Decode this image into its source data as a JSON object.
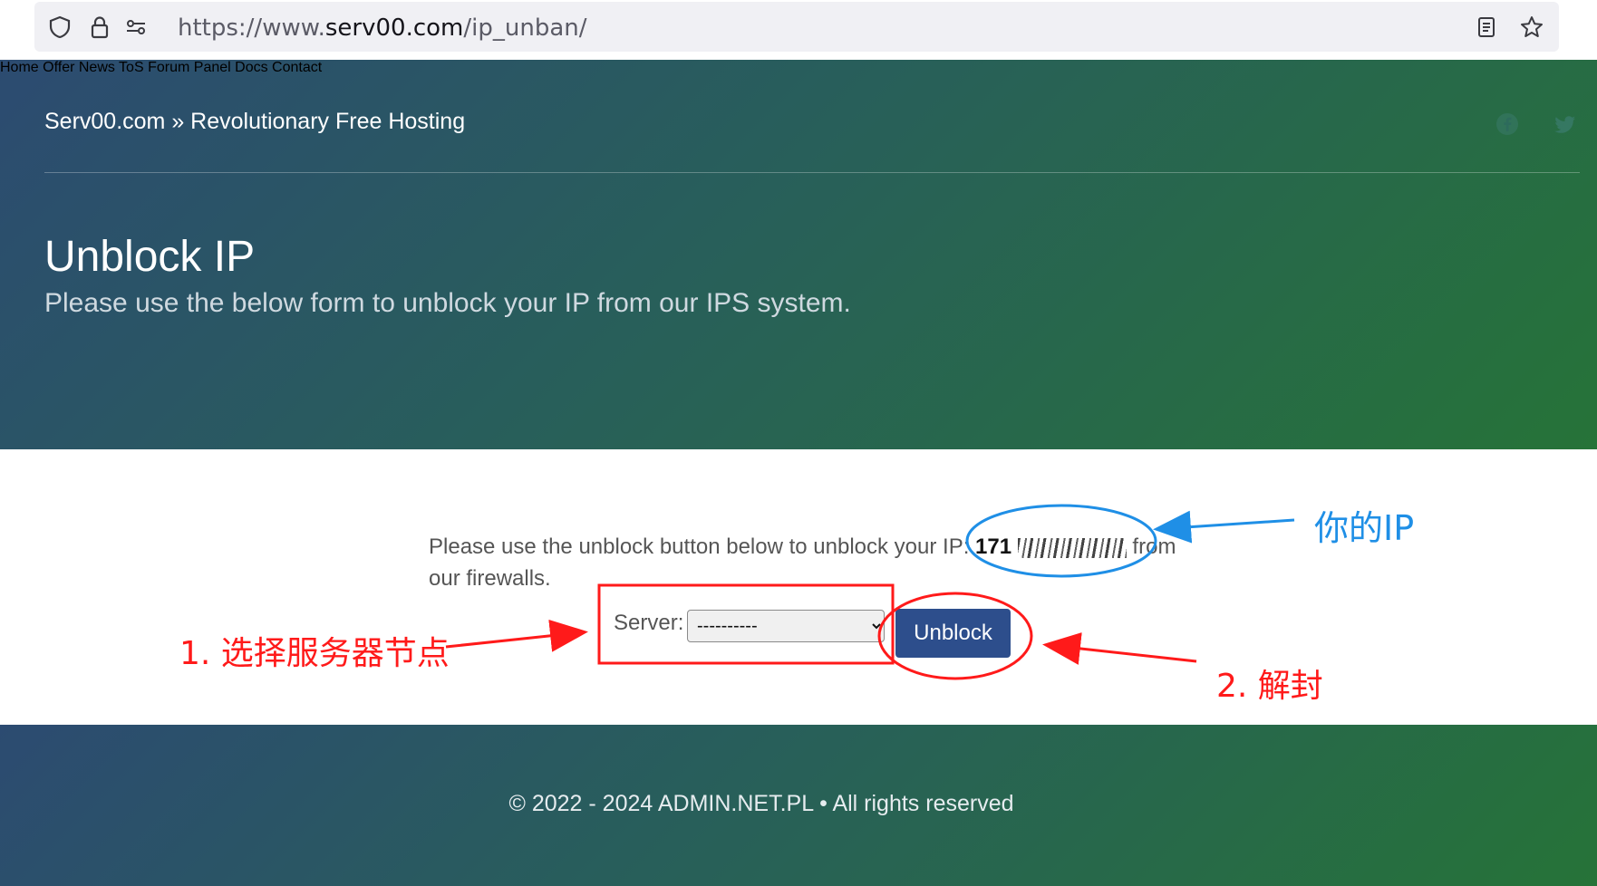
{
  "browser": {
    "url_prefix": "https://www.",
    "url_host": "serv00.com",
    "url_path": "/ip_unban/",
    "icons": [
      "shield-icon",
      "lock-icon",
      "permissions-icon",
      "reader-view-icon",
      "bookmark-star-icon"
    ]
  },
  "header": {
    "brand": "Serv00.com » Revolutionary Free Hosting",
    "nav": [
      "Home",
      "Offer",
      "News",
      "ToS",
      "Forum",
      "Panel",
      "Docs",
      "Contact"
    ],
    "social_icons": [
      "facebook-icon",
      "twitter-icon"
    ]
  },
  "hero": {
    "title": "Unblock IP",
    "subtitle": "Please use the below form to unblock your IP from our IPS system."
  },
  "main": {
    "message_before": "Please use the unblock button below to unblock your IP: ",
    "ip_visible": "171",
    "message_after": " from our firewalls.",
    "server_label": "Server:",
    "server_selected": "----------",
    "unblock_label": "Unblock"
  },
  "footer": {
    "copyright": "© 2022 - 2024 ADMIN.NET.PL • All rights reserved"
  },
  "annotations": {
    "your_ip": "你的IP",
    "step1": "1. 选择服务器节点",
    "step2": "2. 解封"
  },
  "colors": {
    "hero_gradient_start": "#2c4b71",
    "hero_gradient_end": "#267338",
    "button": "#2d4e8c",
    "annotation_red": "#ff1a1a",
    "annotation_blue": "#1f8fe6"
  }
}
